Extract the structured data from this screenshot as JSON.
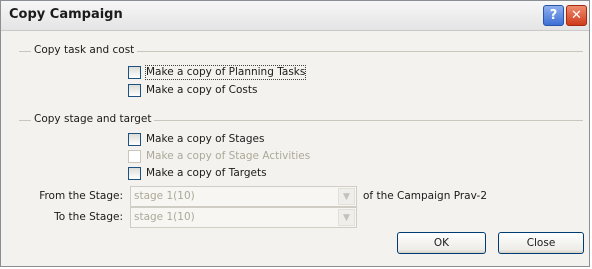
{
  "window": {
    "title": "Copy Campaign",
    "help_glyph": "?",
    "close_glyph": "✕"
  },
  "groups": {
    "task_cost": {
      "label": "Copy task and cost",
      "options": [
        {
          "label": "Make a copy of Planning Tasks",
          "checked": false,
          "enabled": true,
          "focused": true
        },
        {
          "label": "Make a copy of Costs",
          "checked": false,
          "enabled": true
        }
      ]
    },
    "stage_target": {
      "label": "Copy stage and target",
      "options": [
        {
          "label": "Make a copy of Stages",
          "checked": false,
          "enabled": true
        },
        {
          "label": "Make a copy of Stage Activities",
          "checked": false,
          "enabled": false
        },
        {
          "label": "Make a copy of Targets",
          "checked": false,
          "enabled": true
        }
      ]
    }
  },
  "from_stage": {
    "label": "From the Stage:",
    "value": "stage 1(10)",
    "suffix": "of the Campaign Prav-2"
  },
  "to_stage": {
    "label": "To the Stage:",
    "value": "stage 1(10)"
  },
  "buttons": {
    "ok": "OK",
    "close": "Close"
  },
  "icons": {
    "dropdown": "chevron-down-icon"
  }
}
